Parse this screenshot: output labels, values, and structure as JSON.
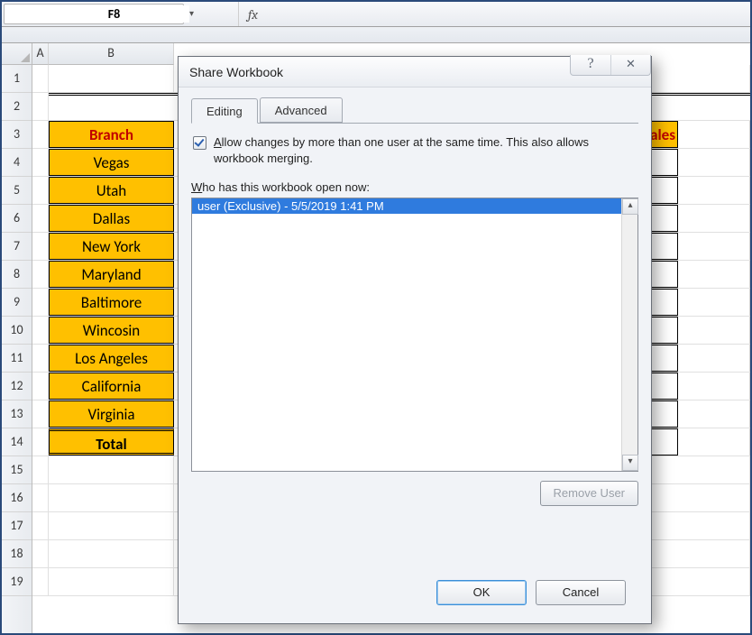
{
  "name_box": "F8",
  "formula_bar": {
    "fx": "fx",
    "value": ""
  },
  "columns": [
    "A",
    "B"
  ],
  "rows": [
    "1",
    "2",
    "3",
    "4",
    "5",
    "6",
    "7",
    "8",
    "9",
    "10",
    "11",
    "12",
    "13",
    "14",
    "15",
    "16",
    "17",
    "18",
    "19"
  ],
  "sheet": {
    "header_branch": "Branch",
    "header_right": "ales",
    "branches": [
      "Vegas",
      "Utah",
      "Dallas",
      "New York",
      "Maryland",
      "Baltimore",
      "Wincosin",
      "Los Angeles",
      "California",
      "Virginia"
    ],
    "total": "Total"
  },
  "dialog": {
    "title": "Share Workbook",
    "help": "?",
    "close": "✕",
    "tabs": {
      "editing": "Editing",
      "advanced": "Advanced"
    },
    "allow_prefix_u": "A",
    "allow_rest": "llow changes by more than one user at the same time.  This also allows workbook merging.",
    "who_prefix_u": "W",
    "who_rest": "ho has this workbook open now:",
    "user_entry": "user (Exclusive) - 5/5/2019 1:41 PM",
    "remove_user": "Remove User",
    "ok": "OK",
    "cancel": "Cancel",
    "scroll_up": "▴",
    "scroll_down": "▾"
  }
}
